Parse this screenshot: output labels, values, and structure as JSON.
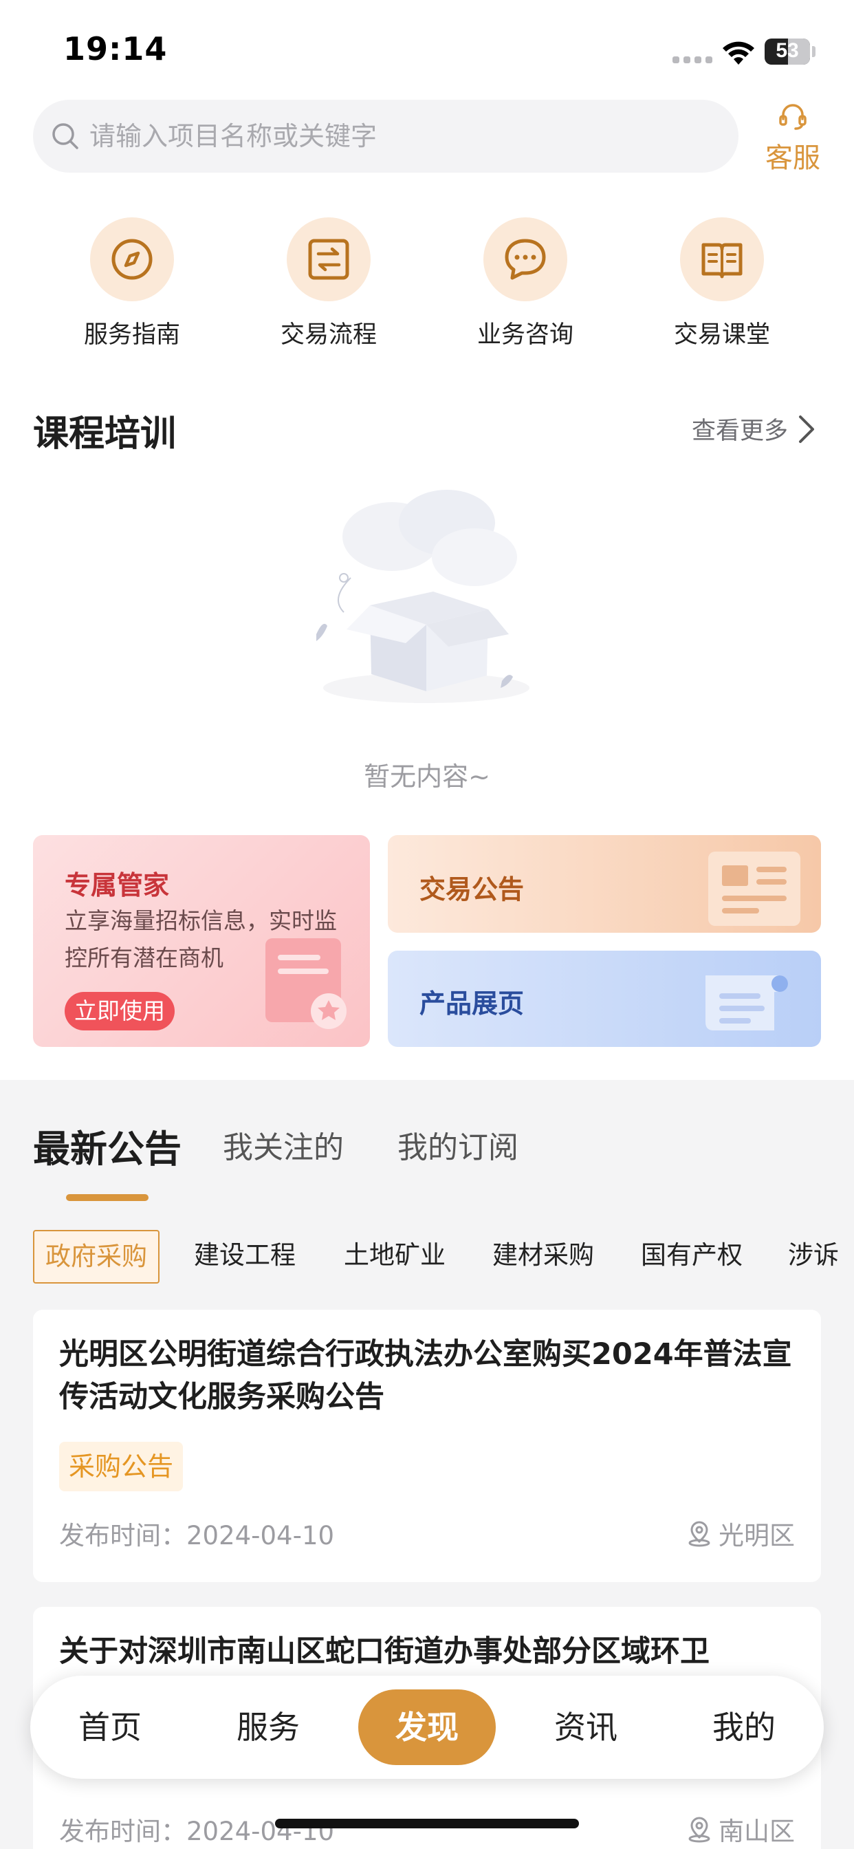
{
  "status_bar": {
    "time": "19:14",
    "battery": "53"
  },
  "search": {
    "placeholder": "请输入项目名称或关键字"
  },
  "service": {
    "label": "客服",
    "icon": "headset-icon"
  },
  "quick_links": [
    {
      "label": "服务指南",
      "icon": "compass-icon"
    },
    {
      "label": "交易流程",
      "icon": "exchange-icon"
    },
    {
      "label": "业务咨询",
      "icon": "chat-icon"
    },
    {
      "label": "交易课堂",
      "icon": "book-icon"
    }
  ],
  "courses": {
    "title": "课程培训",
    "more": "查看更多",
    "empty_text": "暂无内容~"
  },
  "promo": {
    "agent": {
      "title": "专属管家",
      "desc": "立享海量招标信息，实时监控所有潜在商机",
      "button": "立即使用"
    },
    "notice": {
      "title": "交易公告"
    },
    "product": {
      "title": "产品展页"
    }
  },
  "tabs": [
    {
      "label": "最新公告",
      "active": true
    },
    {
      "label": "我关注的",
      "active": false
    },
    {
      "label": "我的订阅",
      "active": false
    }
  ],
  "categories": [
    {
      "label": "政府采购",
      "active": true
    },
    {
      "label": "建设工程",
      "active": false
    },
    {
      "label": "土地矿业",
      "active": false
    },
    {
      "label": "建材采购",
      "active": false
    },
    {
      "label": "国有产权",
      "active": false
    },
    {
      "label": "涉诉",
      "active": false
    }
  ],
  "articles": [
    {
      "title": "光明区公明街道综合行政执法办公室购买2024年普法宣传活动文化服务采购公告",
      "tag": "采购公告",
      "date": "发布时间：2024-04-10",
      "location": "光明区"
    },
    {
      "title": "关于对深圳市南山区蛇口街道办事处部分区域环卫",
      "date": "发布时间：2024-04-10",
      "location": "南山区"
    }
  ],
  "nav": [
    {
      "label": "首页",
      "active": false
    },
    {
      "label": "服务",
      "active": false
    },
    {
      "label": "发现",
      "active": true
    },
    {
      "label": "资讯",
      "active": false
    },
    {
      "label": "我的",
      "active": false
    }
  ],
  "colors": {
    "accent": "#d9953c",
    "red": "#f0535a",
    "blue": "#2a4d9d"
  }
}
